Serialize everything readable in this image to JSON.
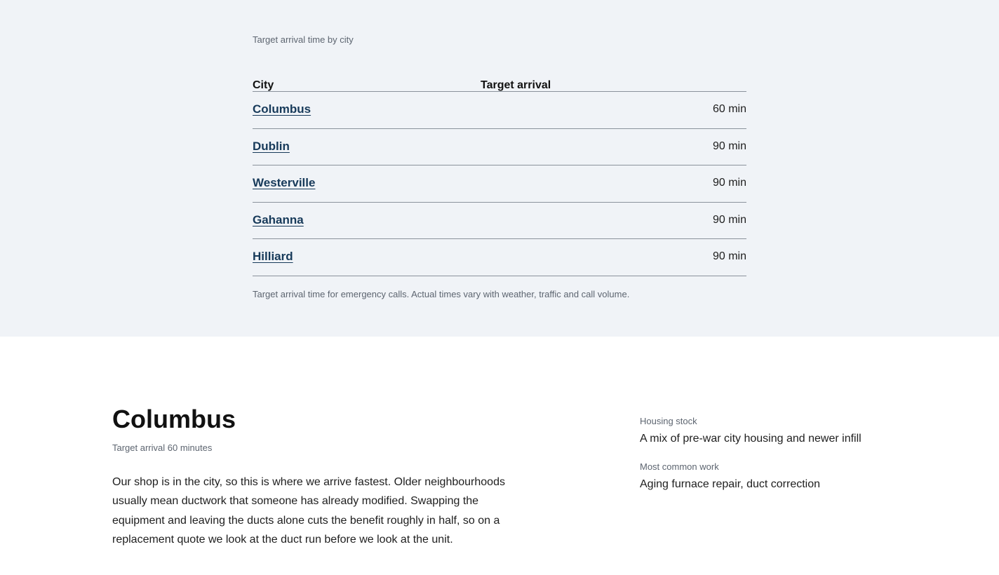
{
  "table": {
    "caption": "Target arrival time by city",
    "headers": {
      "city": "City",
      "arrival": "Target arrival"
    },
    "rows": [
      {
        "city": "Columbus",
        "arrival": "60 min"
      },
      {
        "city": "Dublin",
        "arrival": "90 min"
      },
      {
        "city": "Westerville",
        "arrival": "90 min"
      },
      {
        "city": "Gahanna",
        "arrival": "90 min"
      },
      {
        "city": "Hilliard",
        "arrival": "90 min"
      }
    ],
    "footnote": "Target arrival time for emergency calls. Actual times vary with weather, traffic and call volume."
  },
  "detail": {
    "title": "Columbus",
    "subtitle": "Target arrival 60 minutes",
    "body": "Our shop is in the city, so this is where we arrive fastest. Older neighbourhoods usually mean ductwork that someone has already modified. Swapping the equipment and leaving the ducts alone cuts the benefit roughly in half, so on a replacement quote we look at the duct run before we look at the unit.",
    "facts": [
      {
        "label": "Housing stock",
        "value": "A mix of pre-war city housing and newer infill"
      },
      {
        "label": "Most common work",
        "value": "Aging furnace repair, duct correction"
      }
    ]
  },
  "colors": {
    "band_background": "#f0f3f7",
    "link": "#173a5a",
    "muted_text": "#5d6570",
    "rule": "#8a929c"
  }
}
